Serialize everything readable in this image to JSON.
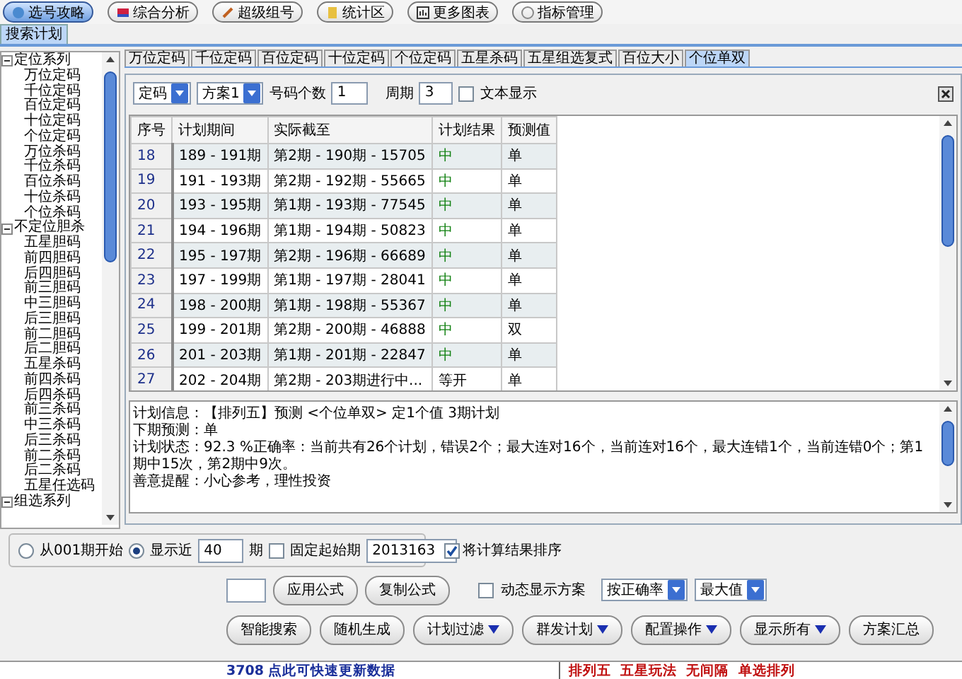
{
  "toolbar": [
    {
      "label": "选号攻略",
      "selected": true
    },
    {
      "label": "综合分析",
      "selected": false
    },
    {
      "label": "超级组号",
      "selected": false
    },
    {
      "label": "统计区",
      "selected": false
    },
    {
      "label": "更多图表",
      "selected": false
    },
    {
      "label": "指标管理",
      "selected": false
    }
  ],
  "main_tabs": [
    {
      "label": "搜索计划",
      "selected": true
    }
  ],
  "tree": [
    {
      "label": "定位系列",
      "expanded": true,
      "children": [
        {
          "label": "万位定码"
        },
        {
          "label": "千位定码"
        },
        {
          "label": "百位定码"
        },
        {
          "label": "十位定码"
        },
        {
          "label": "个位定码"
        },
        {
          "label": "万位杀码"
        },
        {
          "label": "千位杀码"
        },
        {
          "label": "百位杀码"
        },
        {
          "label": "十位杀码"
        },
        {
          "label": "个位杀码"
        }
      ]
    },
    {
      "label": "不定位胆杀",
      "expanded": true,
      "children": [
        {
          "label": "五星胆码"
        },
        {
          "label": "前四胆码"
        },
        {
          "label": "后四胆码"
        },
        {
          "label": "前三胆码"
        },
        {
          "label": "中三胆码"
        },
        {
          "label": "后三胆码"
        },
        {
          "label": "前二胆码"
        },
        {
          "label": "后二胆码"
        },
        {
          "label": "五星杀码"
        },
        {
          "label": "前四杀码"
        },
        {
          "label": "后四杀码"
        },
        {
          "label": "前三杀码"
        },
        {
          "label": "中三杀码"
        },
        {
          "label": "后三杀码"
        },
        {
          "label": "前二杀码"
        },
        {
          "label": "后二杀码"
        },
        {
          "label": "五星任选码"
        }
      ]
    },
    {
      "label": "组选系列",
      "expanded": true
    }
  ],
  "plan_tabs": [
    {
      "label": "万位定码",
      "selected": false
    },
    {
      "label": "千位定码",
      "selected": false
    },
    {
      "label": "百位定码",
      "selected": false
    },
    {
      "label": "十位定码",
      "selected": false
    },
    {
      "label": "个位定码",
      "selected": false
    },
    {
      "label": "五星杀码",
      "selected": false
    },
    {
      "label": "五星组选复式",
      "selected": false
    },
    {
      "label": "百位大小",
      "selected": false
    },
    {
      "label": "个位单双",
      "selected": true
    }
  ],
  "filters": {
    "code_type": "定码",
    "scheme": "方案1",
    "count_label": "号码个数",
    "count": "1",
    "period_label": "周期",
    "period": "3",
    "text_display": {
      "label": "文本显示",
      "checked": false
    }
  },
  "table": {
    "columns": [
      "序号",
      "计划期间",
      "实际截至",
      "计划结果",
      "预测值"
    ],
    "rows": [
      {
        "cells": [
          "18",
          "189 - 191期",
          "第2期 - 190期 - 15705",
          "中",
          "单"
        ],
        "color": "#108010"
      },
      {
        "cells": [
          "19",
          "191 - 193期",
          "第2期 - 192期 - 55665",
          "中",
          "单"
        ],
        "color": "#108010"
      },
      {
        "cells": [
          "20",
          "193 - 195期",
          "第1期 - 193期 - 77545",
          "中",
          "单"
        ],
        "color": "#108010"
      },
      {
        "cells": [
          "21",
          "194 - 196期",
          "第1期 - 194期 - 50823",
          "中",
          "单"
        ],
        "color": "#108010"
      },
      {
        "cells": [
          "22",
          "195 - 197期",
          "第2期 - 196期 - 66689",
          "中",
          "单"
        ],
        "color": "#108010"
      },
      {
        "cells": [
          "23",
          "197 - 199期",
          "第1期 - 197期 - 28041",
          "中",
          "单"
        ],
        "color": "#108010"
      },
      {
        "cells": [
          "24",
          "198 - 200期",
          "第1期 - 198期 - 55367",
          "中",
          "单"
        ],
        "color": "#108010"
      },
      {
        "cells": [
          "25",
          "199 - 201期",
          "第2期 - 200期 - 46888",
          "中",
          "双"
        ],
        "color": "#108010"
      },
      {
        "cells": [
          "26",
          "201 - 203期",
          "第1期 - 201期 - 22847",
          "中",
          "单"
        ],
        "color": "#108010"
      },
      {
        "cells": [
          "27",
          "202 - 204期",
          "第2期 - 203期进行中...",
          "等开",
          "单"
        ],
        "color": "#000000"
      }
    ]
  },
  "info": [
    "计划信息：【排列五】预测 <个位单双> 定1个值 3期计划",
    "下期预测：单",
    "计划状态：92.3 %正确率：当前共有26个计划，错误2个；最大连对16个，当前连对16个，最大连错1个，当前连错0个；第1期中15次，第2期中9次。",
    "善意提醒：小心参考，理性投资"
  ],
  "range": {
    "from_start": {
      "label": "从001期开始",
      "selected": false
    },
    "recent": {
      "label": "显示近",
      "selected": true
    },
    "recent_count": "40",
    "recent_unit": "期",
    "fixed_start": {
      "label": "固定起始期",
      "checked": false
    },
    "start_period": "2013163",
    "sort_results": {
      "label": "将计算结果排序",
      "checked": true
    }
  },
  "formula": {
    "apply": "应用公式",
    "copy": "复制公式",
    "dynamic": {
      "label": "动态显示方案",
      "checked": false
    },
    "sort_by": "按正确率",
    "sort_value": "最大值"
  },
  "actions": [
    {
      "label": "智能搜索",
      "kind": "plain"
    },
    {
      "label": "随机生成",
      "kind": "plain"
    },
    {
      "label": "计划过滤",
      "kind": "menu"
    },
    {
      "label": "群发计划",
      "kind": "menu"
    },
    {
      "label": "配置操作",
      "kind": "menu"
    },
    {
      "label": "显示所有",
      "kind": "menu"
    },
    {
      "label": "方案汇总",
      "kind": "plain"
    }
  ],
  "status_bar": {
    "left": "3708 点此可快速更新数据",
    "right": "排列五  五星玩法  无间隔  单选排列"
  }
}
